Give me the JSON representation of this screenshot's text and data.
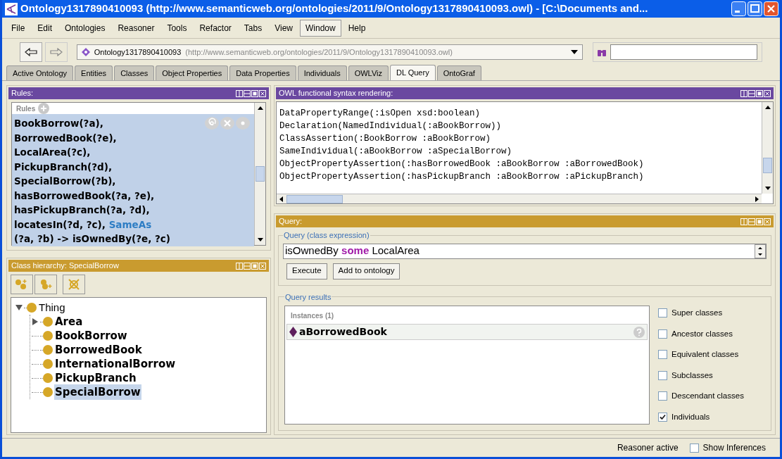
{
  "window": {
    "title": "Ontology1317890410093 (http://www.semanticweb.org/ontologies/2011/9/Ontology1317890410093.owl) - [C:\\Documents and..."
  },
  "menu": [
    {
      "label": "File",
      "selected": false
    },
    {
      "label": "Edit",
      "selected": false
    },
    {
      "label": "Ontologies",
      "selected": false
    },
    {
      "label": "Reasoner",
      "selected": false
    },
    {
      "label": "Tools",
      "selected": false
    },
    {
      "label": "Refactor",
      "selected": false
    },
    {
      "label": "Tabs",
      "selected": false
    },
    {
      "label": "View",
      "selected": false
    },
    {
      "label": "Window",
      "selected": true
    },
    {
      "label": "Help",
      "selected": false
    }
  ],
  "address": {
    "name": "Ontology1317890410093",
    "iri": "(http://www.semanticweb.org/ontologies/2011/9/Ontology1317890410093.owl)"
  },
  "tabs": [
    {
      "label": "Active Ontology",
      "selected": false
    },
    {
      "label": "Entities",
      "selected": false
    },
    {
      "label": "Classes",
      "selected": false
    },
    {
      "label": "Object Properties",
      "selected": false
    },
    {
      "label": "Data Properties",
      "selected": false
    },
    {
      "label": "Individuals",
      "selected": false
    },
    {
      "label": "OWLViz",
      "selected": false
    },
    {
      "label": "DL Query",
      "selected": true
    },
    {
      "label": "OntoGraf",
      "selected": false
    }
  ],
  "rules_panel": {
    "title": "Rules:",
    "list_header": "Rules",
    "rule": {
      "selected": true,
      "lines": [
        [
          {
            "text": "BookBorrow(?a),",
            "kind": "atom"
          }
        ],
        [
          {
            "text": "BorrowedBook(?e),",
            "kind": "atom"
          }
        ],
        [
          {
            "text": "LocalArea(?c),",
            "kind": "atom"
          }
        ],
        [
          {
            "text": "PickupBranch(?d),",
            "kind": "atom"
          }
        ],
        [
          {
            "text": "SpecialBorrow(?b),",
            "kind": "atom"
          }
        ],
        [
          {
            "text": "hasBorrowedBook(?a, ?e),",
            "kind": "atom"
          }
        ],
        [
          {
            "text": "hasPickupBranch(?a, ?d),",
            "kind": "atom"
          }
        ],
        [
          {
            "text": "locatesIn(?d, ?c),",
            "kind": "atom"
          },
          {
            "text": "SameAs",
            "kind": "builtin"
          }
        ],
        [
          {
            "text": "(?a, ?b) -> isOwnedBy(?e, ?c)",
            "kind": "atom"
          }
        ]
      ]
    }
  },
  "class_hierarchy": {
    "title": "Class hierarchy: SpecialBorrow",
    "tree": [
      {
        "label": "Thing",
        "expanded": true,
        "selected": false,
        "children": [
          {
            "label": "Area",
            "expanded": false,
            "selected": false
          },
          {
            "label": "BookBorrow",
            "selected": false
          },
          {
            "label": "BorrowedBook",
            "selected": false
          },
          {
            "label": "InternationalBorrow",
            "selected": false
          },
          {
            "label": "PickupBranch",
            "selected": false
          },
          {
            "label": "SpecialBorrow",
            "selected": true
          }
        ]
      }
    ]
  },
  "owl_panel": {
    "title": "OWL functional syntax rendering:",
    "lines": [
      "DataPropertyRange(:isOpen xsd:boolean)",
      "Declaration(NamedIndividual(:aBookBorrow))",
      "ClassAssertion(:BookBorrow :aBookBorrow)",
      "SameIndividual(:aBookBorrow :aSpecialBorrow)",
      "ObjectPropertyAssertion(:hasBorrowedBook :aBookBorrow :aBorrowedBook)",
      "ObjectPropertyAssertion(:hasPickupBranch :aBookBorrow :aPickupBranch)"
    ]
  },
  "query_panel": {
    "title": "Query:",
    "expression_legend": "Query (class expression)",
    "expression": [
      {
        "text": "isOwnedBy",
        "kind": "name"
      },
      {
        "text": "some",
        "kind": "keyword"
      },
      {
        "text": "LocalArea",
        "kind": "name"
      }
    ],
    "buttons": [
      "Execute",
      "Add to ontology"
    ],
    "results_legend": "Query results",
    "list_header": "Instances (1)",
    "results": [
      {
        "label": "aBorrowedBook"
      }
    ],
    "options": [
      {
        "label": "Super classes",
        "checked": false
      },
      {
        "label": "Ancestor classes",
        "checked": false
      },
      {
        "label": "Equivalent classes",
        "checked": false
      },
      {
        "label": "Subclasses",
        "checked": false
      },
      {
        "label": "Descendant classes",
        "checked": false
      },
      {
        "label": "Individuals",
        "checked": true
      }
    ]
  },
  "status_bar": {
    "text": "Reasoner active",
    "show_inferences": {
      "label": "Show Inferences",
      "checked": false
    }
  }
}
